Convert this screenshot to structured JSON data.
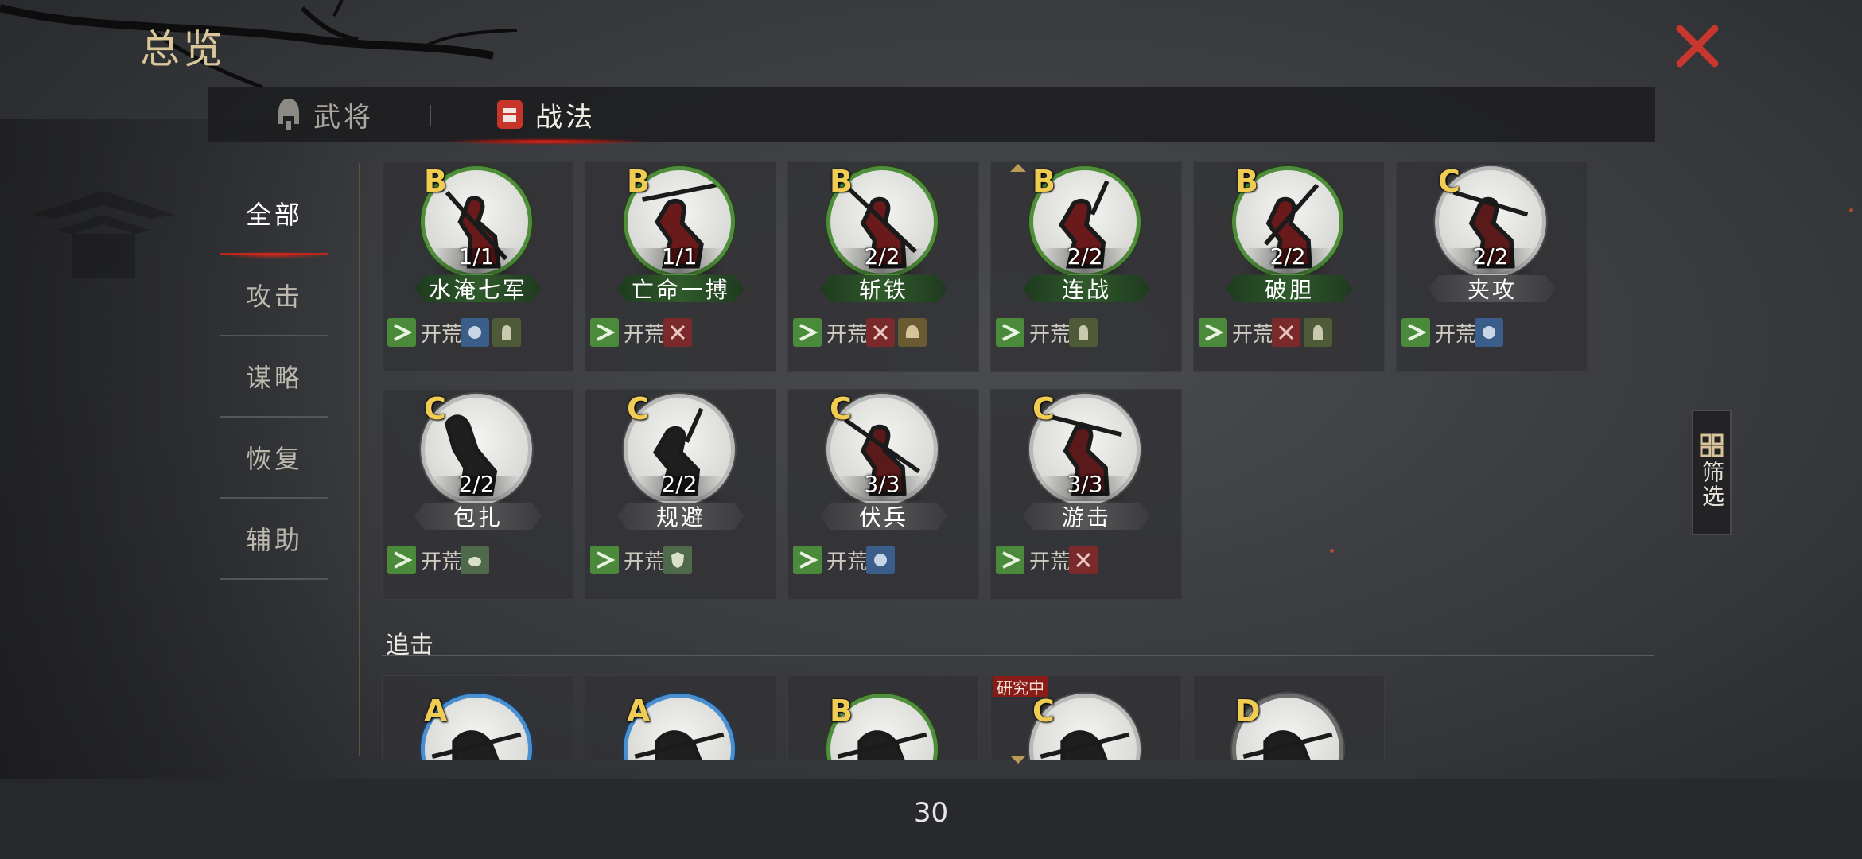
{
  "header": {
    "title": "总览"
  },
  "tabs": [
    {
      "label": "武将",
      "icon": "helmet-icon"
    },
    {
      "label": "战法",
      "icon": "fist-icon"
    }
  ],
  "categories": [
    "全部",
    "攻击",
    "谋略",
    "恢复",
    "辅助"
  ],
  "cards_row1": [
    {
      "grade": "B",
      "level": "1/1",
      "name": "水淹七军"
    },
    {
      "grade": "B",
      "level": "1/1",
      "name": "亡命一搏"
    },
    {
      "grade": "B",
      "level": "2/2",
      "name": "斩铁"
    },
    {
      "grade": "B",
      "level": "2/2",
      "name": "连战"
    },
    {
      "grade": "B",
      "level": "2/2",
      "name": "破胆"
    },
    {
      "grade": "C",
      "level": "2/2",
      "name": "夹攻"
    }
  ],
  "cards_row2": [
    {
      "grade": "C",
      "level": "2/2",
      "name": "包扎"
    },
    {
      "grade": "C",
      "level": "2/2",
      "name": "规避"
    },
    {
      "grade": "C",
      "level": "3/3",
      "name": "伏兵"
    },
    {
      "grade": "C",
      "level": "3/3",
      "name": "游击"
    }
  ],
  "tag_label": "开荒",
  "section": {
    "title": "追击"
  },
  "cards_row3": [
    {
      "grade": "A"
    },
    {
      "grade": "A"
    },
    {
      "grade": "B"
    },
    {
      "grade": "C",
      "badge": "研究中"
    },
    {
      "grade": "D"
    }
  ],
  "filter": {
    "label": "筛选"
  },
  "footer": {
    "count": "30"
  },
  "colors": {
    "gold": "#d9c79a",
    "accent_red": "#b8281c",
    "green_ring": "#4f8f3c",
    "blue_ring": "#4a8fd0",
    "grade_yellow": "#f1cc52"
  }
}
